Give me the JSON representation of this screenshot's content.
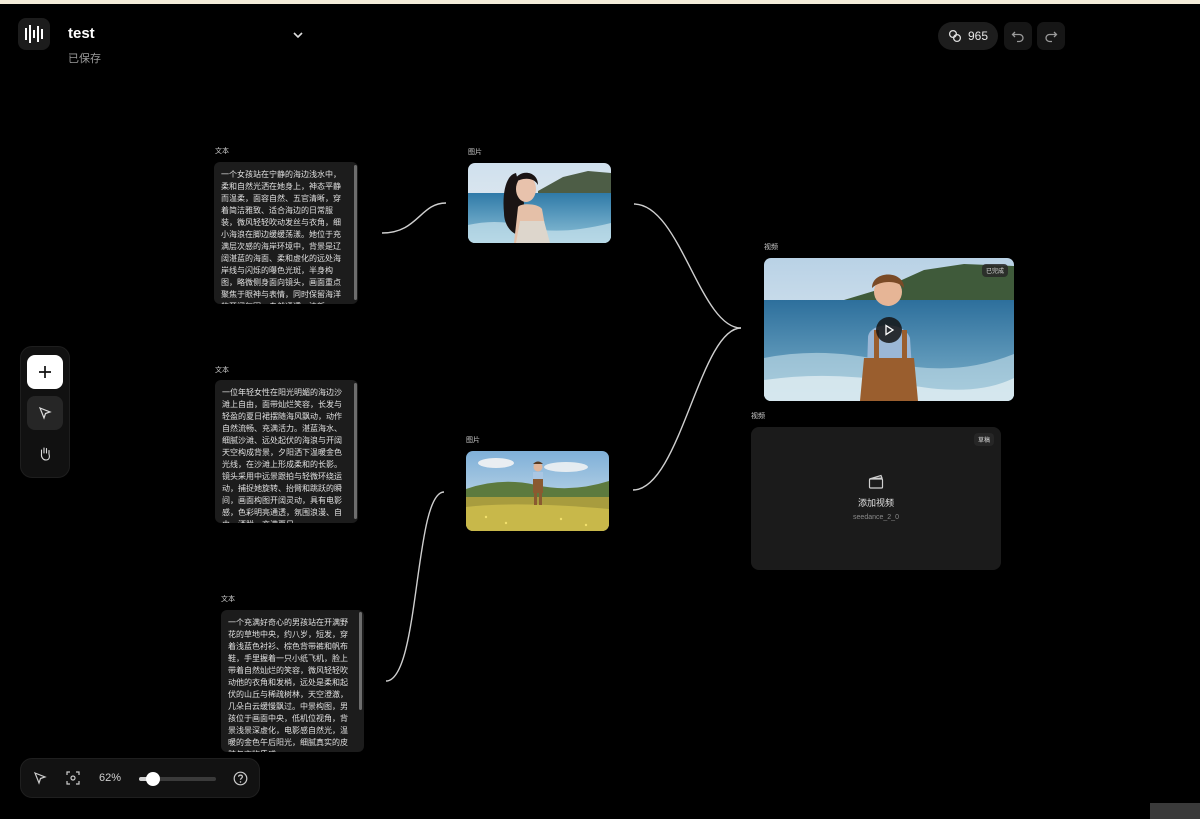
{
  "header": {
    "title": "test",
    "status": "已保存",
    "credits": "965"
  },
  "canvas": {
    "text_nodes": [
      {
        "label": "文本",
        "content": "一个女孩站在宁静的海边浅水中，柔和自然光洒在她身上，神态平静而温柔，面容自然、五官清晰，穿着简洁雅致、适合海边的日常服装，微风轻轻吹动发丝与衣角，细小海浪在脚边缓缓荡漾。她位于充满层次感的海岸环境中，背景是辽阔湛蓝的海面、柔和虚化的远处海岸线与闪烁的曝色光斑，半身构图，略微侧身面向镜头，画面重点聚焦于眼神与表情，同时保留海洋的开阔氛围，自然通透，清新"
      },
      {
        "label": "文本",
        "content": "一位年轻女性在阳光明媚的海边沙滩上自由，面带灿烂笑容，长发与轻盈的夏日裙摆随海风飘动，动作自然流畅、充满活力。湛蓝海水、细腻沙滩、远处起伏的海浪与开阔天空构成背景，夕阳洒下温暖金色光线，在沙滩上形成柔和的长影。镜头采用中远景跟拍与轻微环绕运动，捕捉她旋转、抬臂和跳跃的瞬间，画面构图开阔灵动，具有电影感，色彩明亮通透，氛围浪漫、自由、洒脱，充满夏日"
      },
      {
        "label": "文本",
        "content": "一个充满好奇心的男孩站在开满野花的草地中央，约八岁，短发，穿着浅蓝色衬衫、棕色背带裤和帆布鞋，手里握着一只小纸飞机，脸上带着自然灿烂的笑容，微风轻轻吹动他的衣角和发梢，远处是柔和起伏的山丘与稀疏树林，天空澄澈，几朵白云缓慢飘过。中景构图，男孩位于画面中央，低机位视角，背景浅景深虚化，电影感自然光，温暖的金色午后阳光，细腻真实的皮肤与衣物质感"
      }
    ],
    "image_nodes": [
      {
        "label": "图片"
      },
      {
        "label": "图片"
      }
    ],
    "video_nodes": [
      {
        "label": "视频",
        "badge": "已完成"
      },
      {
        "label": "视频",
        "badge": "草稿",
        "action": "添加视频",
        "model": "seedance_2_0"
      }
    ]
  },
  "bottom_toolbar": {
    "zoom": "62%",
    "zoom_value": 0.62
  }
}
